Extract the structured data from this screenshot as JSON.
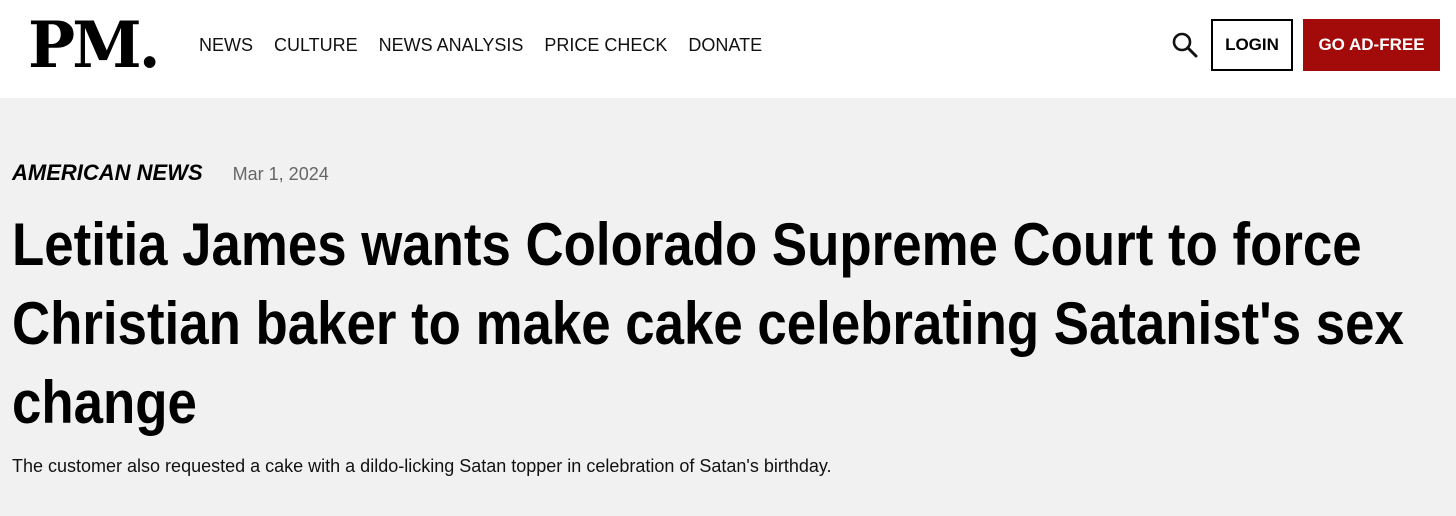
{
  "header": {
    "logo": "PM.",
    "nav": [
      "NEWS",
      "CULTURE",
      "NEWS ANALYSIS",
      "PRICE CHECK",
      "DONATE"
    ],
    "search_icon": "search-icon",
    "login_label": "LOGIN",
    "adfree_label": "GO AD-FREE",
    "adfree_color": "#a30b0b"
  },
  "article": {
    "category": "AMERICAN NEWS",
    "date": "Mar 1, 2024",
    "headline": "Letitia James wants Colorado Supreme Court to force Christian baker to make cake celebrating Satanist's sex change",
    "subtitle": "The customer also requested a cake with a dildo-licking Satan topper in celebration of Satan's birthday."
  }
}
